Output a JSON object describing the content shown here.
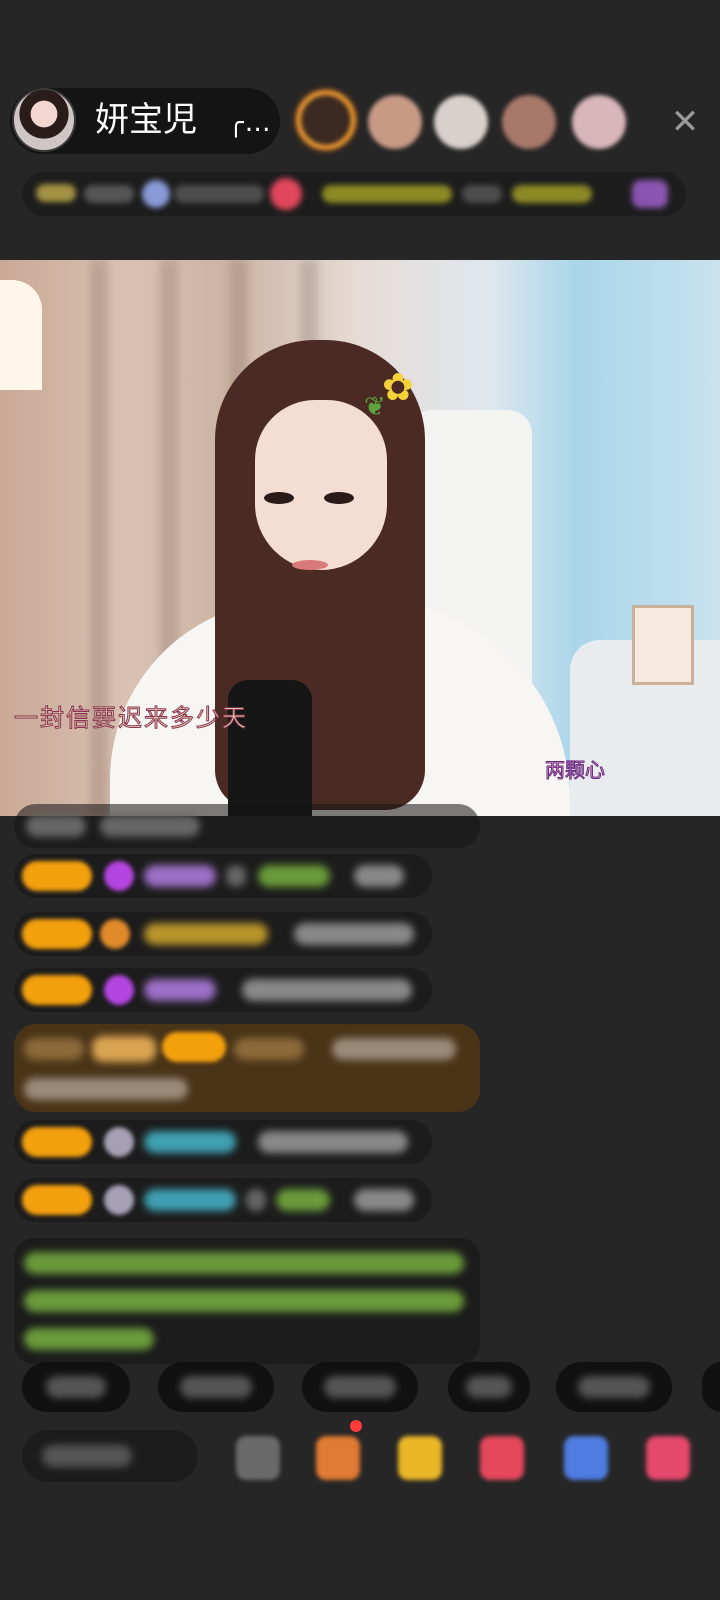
{
  "header": {
    "host_name": "妍宝児",
    "host_name_suffix": "╭…",
    "close_label": "✕",
    "viewer_count": 5
  },
  "stream": {
    "lyric_left": "一封信要迟来多少天",
    "lyric_right": "两颗心"
  },
  "chat": {
    "messages": [
      "",
      "",
      "",
      "",
      "",
      "",
      "",
      ""
    ]
  },
  "quick_replies": [
    "",
    "",
    "",
    "",
    "",
    ""
  ],
  "input": {
    "placeholder": ""
  },
  "colors": {
    "badge": "#f3a00d",
    "accent_pink": "#ff3b6b",
    "bg": "#262626"
  }
}
